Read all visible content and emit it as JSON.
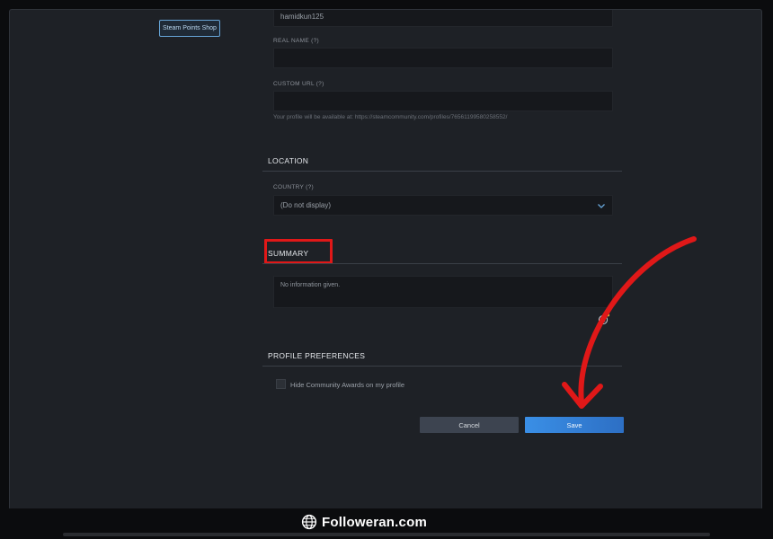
{
  "sidebar": {
    "points_shop_label": "Steam Points Shop"
  },
  "profile": {
    "username_value": "hamidkun125",
    "real_name_label": "REAL NAME (?)",
    "real_name_value": "",
    "custom_url_label": "CUSTOM URL (?)",
    "custom_url_value": "",
    "url_hint": "Your profile will be available at: https://steamcommunity.com/profiles/76561199580258552/"
  },
  "location": {
    "title": "LOCATION",
    "country_label": "COUNTRY (?)",
    "country_value": "(Do not display)"
  },
  "summary": {
    "title": "SUMMARY",
    "placeholder": "No information given."
  },
  "preferences": {
    "title": "PROFILE PREFERENCES",
    "hide_awards_label": "Hide Community Awards on my profile",
    "hide_awards_checked": false
  },
  "actions": {
    "cancel_label": "Cancel",
    "save_label": "Save"
  },
  "overlay": {
    "highlight_color": "#e01818",
    "arrow_color": "#e01818"
  },
  "footer": {
    "brand": "Followeran.com"
  },
  "icons": {
    "select_chevron": "chevron-down-icon",
    "emoji": "emoji-icon",
    "brand_logo": "globe-icon"
  }
}
